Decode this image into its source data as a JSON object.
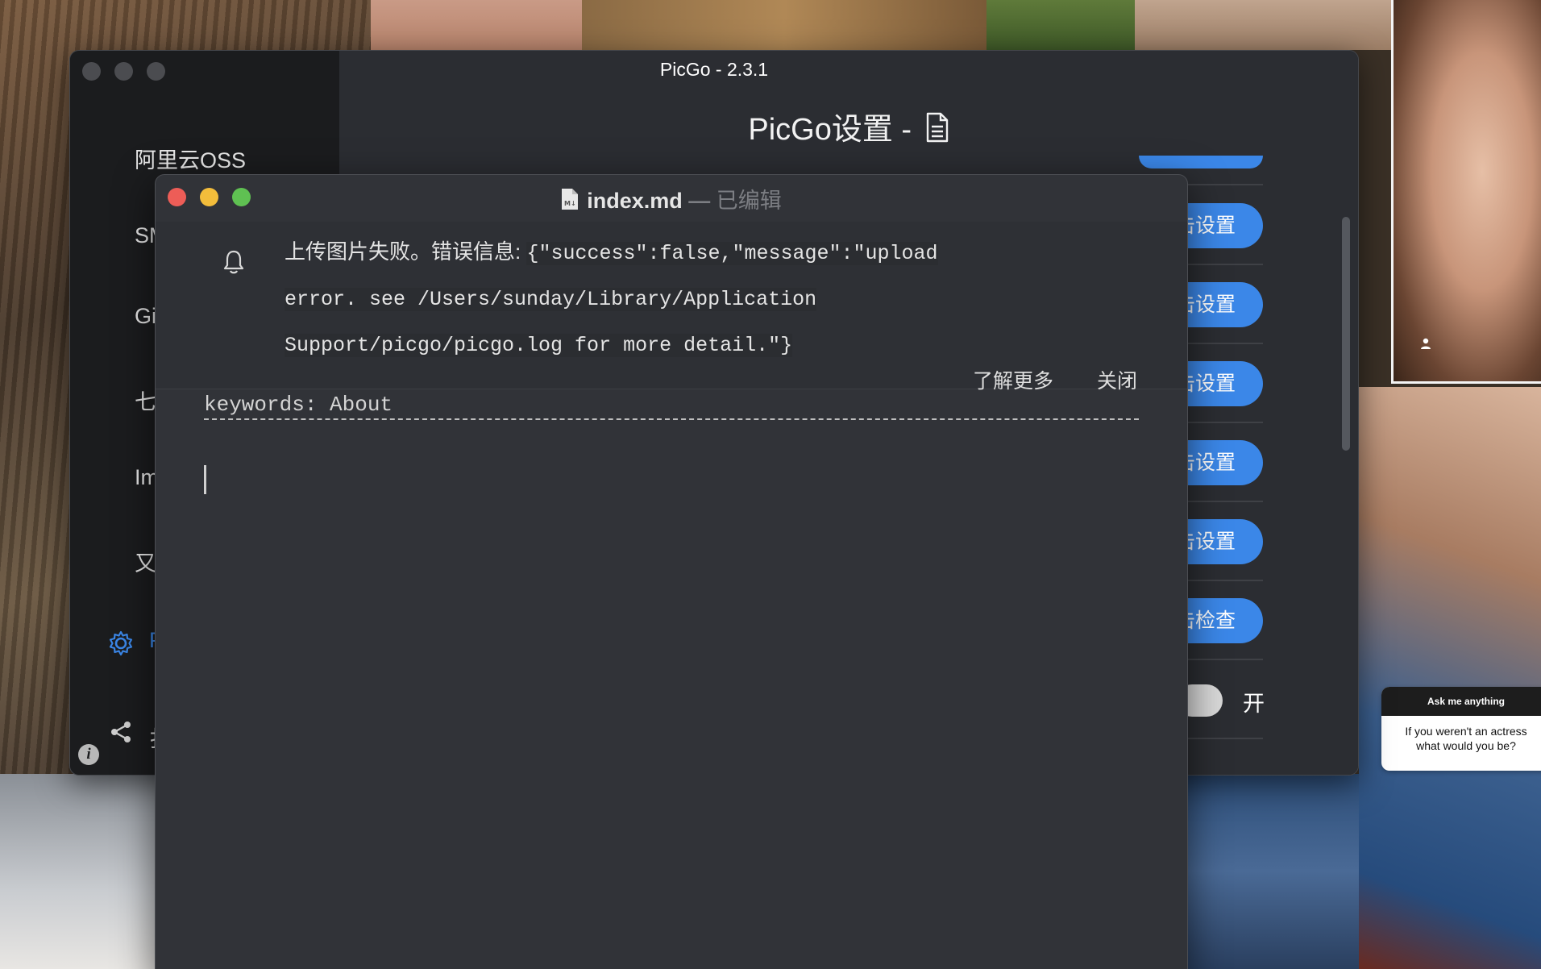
{
  "wallpaper": {
    "ask_card": {
      "title": "Ask me anything",
      "question": "If you weren't an actress\nwhat would you be?"
    }
  },
  "picgo": {
    "window_title": "PicGo - 2.3.1",
    "page_heading": "PicGo设置 - ",
    "sidebar": {
      "items": [
        {
          "label": "阿里云OSS",
          "active": false
        },
        {
          "label": "SM",
          "active": false
        },
        {
          "label": "Gi",
          "active": false
        },
        {
          "label": "七",
          "active": false
        },
        {
          "label": "Im",
          "active": false
        },
        {
          "label": "又",
          "active": false
        },
        {
          "label": "P",
          "active": true,
          "icon": "gear-icon"
        },
        {
          "label": "扌",
          "active": false,
          "icon": "share-icon"
        }
      ]
    },
    "settings_buttons": [
      {
        "label": "点击设置"
      },
      {
        "label": "点击设置"
      },
      {
        "label": "点击设置"
      },
      {
        "label": "点击设置"
      },
      {
        "label": "点击设置"
      },
      {
        "label": "点击检查"
      }
    ],
    "toggle": {
      "label": "开",
      "state": "on"
    }
  },
  "editor": {
    "filename": "index.md",
    "separator": " — ",
    "status": "已编辑",
    "notification": {
      "message": "上传图片失败。错误信息: ",
      "detail": "{\"success\":false,\"message\":\"upload error. see /Users/sunday/Library/Application Support/picgo/picgo.log for more detail.\"}",
      "learn_more": "了解更多",
      "close": "关闭"
    },
    "front_matter": "keywords: About"
  },
  "colors": {
    "accent": "#3b87e8",
    "close": "#ed5d57",
    "minimize": "#f3bd3b",
    "zoom": "#5fc152"
  }
}
